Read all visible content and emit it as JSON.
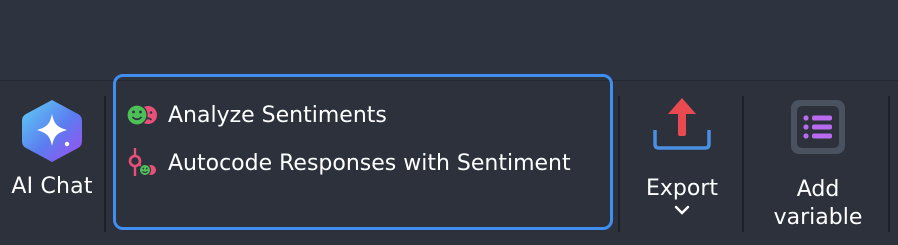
{
  "toolbar": {
    "ai_chat": {
      "label": "AI Chat",
      "icon": "ai-sparkle-icon"
    },
    "sentiment_menu": {
      "items": [
        {
          "label": "Analyze Sentiments",
          "icon": "sentiment-faces-icon"
        },
        {
          "label": "Autocode Responses with Sentiment",
          "icon": "autocode-sentiment-icon"
        }
      ]
    },
    "export": {
      "label": "Export",
      "icon": "upload-icon",
      "dropdown_icon": "chevron-down-icon"
    },
    "add_variable": {
      "label_line1": "Add",
      "label_line2": "variable",
      "icon": "list-icon"
    }
  },
  "colors": {
    "background": "#2e3340",
    "focus_border": "#3f8ef0",
    "export_arrow": "#e84a50",
    "export_tray": "#4a90e2",
    "list_icon": "#b86bf0",
    "positive_face": "#4cc057",
    "negative_face": "#e8507a"
  }
}
